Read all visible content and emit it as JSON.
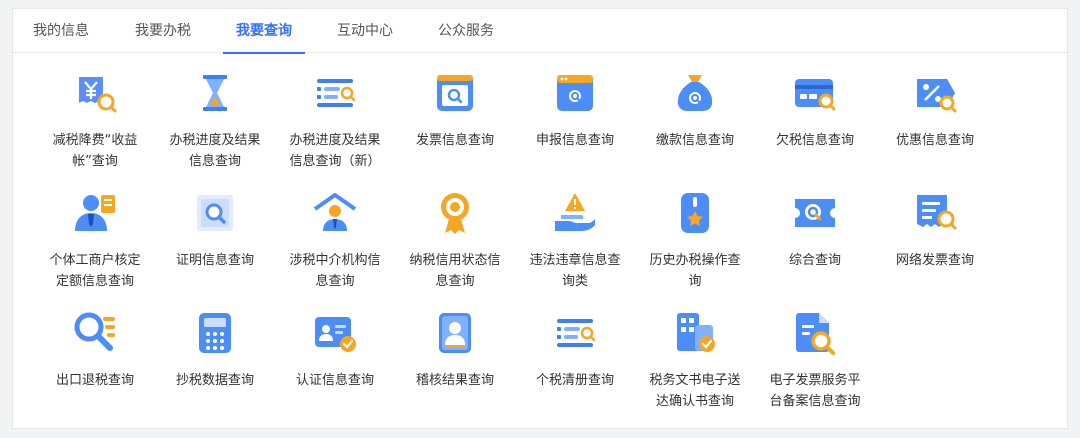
{
  "tabs": [
    {
      "label": "我的信息",
      "active": false
    },
    {
      "label": "我要办税",
      "active": false
    },
    {
      "label": "我要查询",
      "active": true
    },
    {
      "label": "互动中心",
      "active": false
    },
    {
      "label": "公众服务",
      "active": false
    }
  ],
  "colors": {
    "accent": "#3370ff",
    "icon_blue": "#4c8df6",
    "icon_orange": "#f5a623"
  },
  "items": [
    {
      "label": "减税降费“收益帐”查询",
      "icon": "yuan-receipt-icon"
    },
    {
      "label": "办税进度及结果信息查询",
      "icon": "hourglass-icon"
    },
    {
      "label": "办税进度及结果信息查询（新）",
      "icon": "list-search-icon"
    },
    {
      "label": "发票信息查询",
      "icon": "invoice-search-icon"
    },
    {
      "label": "申报信息查询",
      "icon": "declaration-search-icon"
    },
    {
      "label": "缴款信息查询",
      "icon": "money-bag-icon"
    },
    {
      "label": "欠税信息查询",
      "icon": "card-search-icon"
    },
    {
      "label": "优惠信息查询",
      "icon": "discount-tag-icon"
    },
    {
      "label": "个体工商户核定定额信息查询",
      "icon": "business-person-icon"
    },
    {
      "label": "证明信息查询",
      "icon": "certificate-search-icon"
    },
    {
      "label": "涉税中介机构信息查询",
      "icon": "agency-house-icon"
    },
    {
      "label": "纳税信用状态信息查询",
      "icon": "credit-medal-icon"
    },
    {
      "label": "违法违章信息查询类",
      "icon": "warning-hand-icon"
    },
    {
      "label": "历史办税操作查询",
      "icon": "history-star-icon"
    },
    {
      "label": "综合查询",
      "icon": "ticket-search-icon"
    },
    {
      "label": "网络发票查询",
      "icon": "network-invoice-icon"
    },
    {
      "label": "出口退税查询",
      "icon": "export-refund-icon"
    },
    {
      "label": "抄税数据查询",
      "icon": "calculator-icon"
    },
    {
      "label": "认证信息查询",
      "icon": "id-card-check-icon"
    },
    {
      "label": "稽核结果查询",
      "icon": "audit-badge-icon"
    },
    {
      "label": "个税清册查询",
      "icon": "tax-list-icon"
    },
    {
      "label": "税务文书电子送达确认书查询",
      "icon": "document-building-icon"
    },
    {
      "label": "电子发票服务平台备案信息查询",
      "icon": "e-invoice-record-icon"
    }
  ]
}
